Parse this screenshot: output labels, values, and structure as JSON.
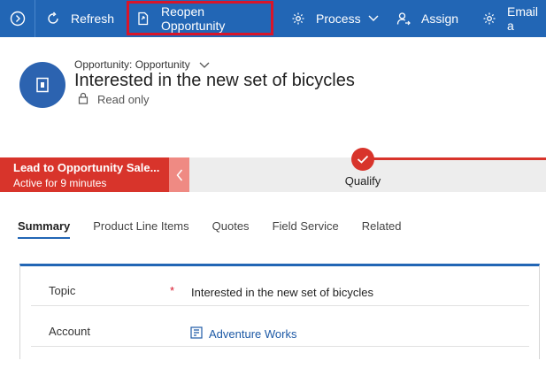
{
  "command_bar": {
    "refresh_label": "Refresh",
    "reopen_label": "Reopen Opportunity",
    "process_label": "Process",
    "assign_label": "Assign",
    "email_label": "Email a"
  },
  "header": {
    "entity_line": "Opportunity: Opportunity",
    "title": "Interested in the new set of bicycles",
    "read_only_label": "Read only"
  },
  "process": {
    "active_stage_name": "Lead to Opportunity Sale...",
    "active_stage_duration": "Active for 9 minutes",
    "current_stage_label": "Qualify"
  },
  "tabs": [
    {
      "label": "Summary",
      "active": true
    },
    {
      "label": "Product Line Items",
      "active": false
    },
    {
      "label": "Quotes",
      "active": false
    },
    {
      "label": "Field Service",
      "active": false
    },
    {
      "label": "Related",
      "active": false
    }
  ],
  "form": {
    "topic_label": "Topic",
    "required_mark": "*",
    "topic_value": "Interested in the new set of bicycles",
    "account_label": "Account",
    "account_value": "Adventure Works"
  },
  "colors": {
    "command_bar": "#2266b5",
    "highlight": "#d8152a",
    "stage_active": "#d8342b",
    "link": "#1e5aa6"
  }
}
